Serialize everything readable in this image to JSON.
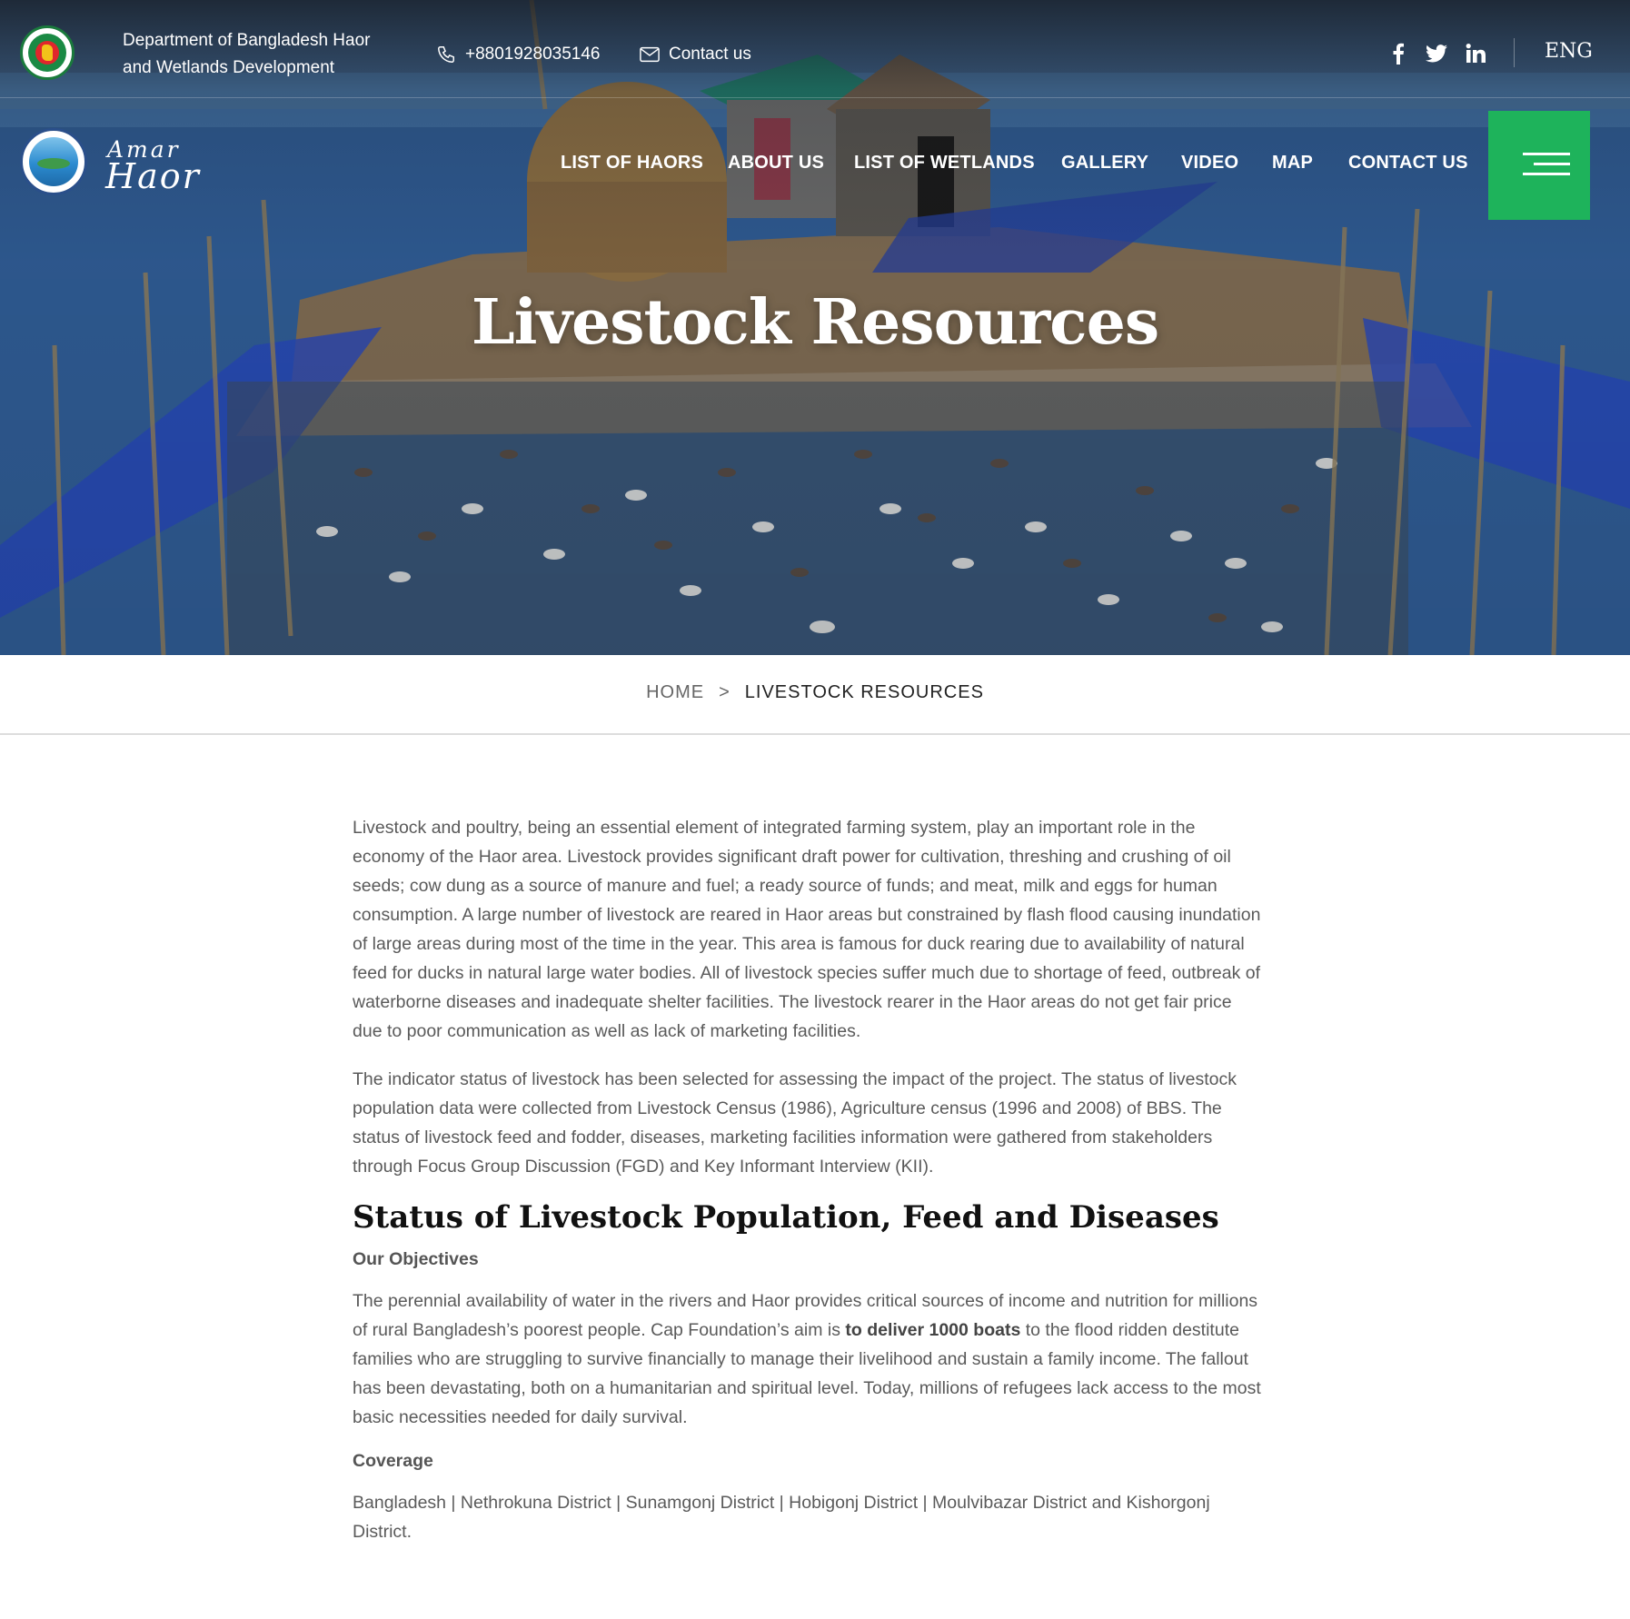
{
  "header": {
    "department_name": "Department of Bangladesh Haor and Wetlands Development",
    "phone": "+8801928035146",
    "contact_link": "Contact us",
    "social": [
      "facebook-icon",
      "twitter-icon",
      "linkedin-icon"
    ],
    "language": "ENG"
  },
  "logo": {
    "line1": "Amar",
    "line2": "Haor"
  },
  "nav": {
    "items": [
      "LIST OF HAORS",
      "ABOUT US",
      "LIST OF WETLANDS",
      "GALLERY",
      "VIDEO",
      "MAP",
      "CONTACT US"
    ],
    "menu_icon": "hamburger-menu-icon"
  },
  "hero": {
    "title": "Livestock Resources"
  },
  "breadcrumb": {
    "home": "HOME",
    "separator": ">",
    "current": "LIVESTOCK RESOURCES"
  },
  "content": {
    "paragraph1": "Livestock and poultry, being an essential element of integrated farming system, play an important role in the economy of the Haor area. Livestock provides significant draft power for cultivation, threshing and crushing of oil seeds; cow dung as a source of manure and fuel; a ready source of funds; and meat, milk and eggs for human consumption. A large number of livestock are reared in Haor areas but constrained by flash flood causing inundation of large areas during most of the time in the year. This area is famous for duck rearing due to availability of natural feed for ducks in natural large water bodies. All of livestock species suffer much due to shortage of feed, outbreak of waterborne diseases and inadequate shelter facilities. The livestock rearer in the Haor areas do not get fair price due to poor communication as well as lack of marketing facilities.",
    "paragraph2": "The indicator status of livestock has been selected for assessing the impact of the project. The status of livestock population data were collected from Livestock Census (1986), Agriculture census (1996 and 2008) of BBS. The status of livestock feed and fodder, diseases, marketing facilities information were gathered from stakeholders through Focus Group Discussion (FGD) and Key Informant Interview (KII).",
    "section_heading": "Status of Livestock Population, Feed and Diseases",
    "objectives_heading": "Our Objectives",
    "objectives_before": "The perennial availability of water in the rivers and Haor provides critical sources of income and nutrition for millions of rural Bangladesh’s poorest people. Cap Foundation’s aim is ",
    "objectives_bold": "to deliver 1000 boats",
    "objectives_after": " to the flood ridden destitute families who are struggling to survive financially to manage their livelihood and sustain a family income. The fallout has been devastating, both on a humanitarian and spiritual level. Today, millions of refugees lack access to the most basic necessities needed for daily survival.",
    "coverage_heading": "Coverage",
    "coverage_text": "Bangladesh | Nethrokuna District | Sunamgonj District | Hobigonj District | Moulvibazar District and Kishorgonj District."
  },
  "colors": {
    "accent_green": "#1eb35b",
    "heading": "#111111",
    "body_text": "#5a5a5a"
  }
}
